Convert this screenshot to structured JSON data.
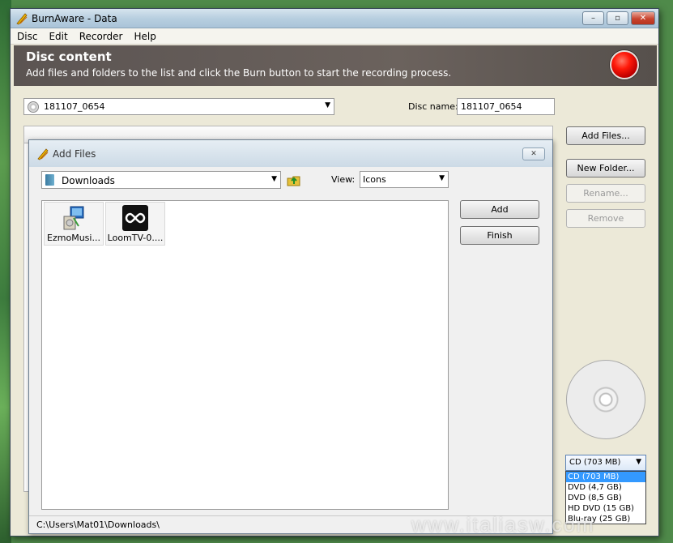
{
  "window": {
    "title": "BurnAware - Data",
    "controls": {
      "minimize": "–",
      "maximize": "▫",
      "close": "✕"
    }
  },
  "menu": [
    "Disc",
    "Edit",
    "Recorder",
    "Help"
  ],
  "banner": {
    "title": "Disc content",
    "subtitle": "Add files and folders to the list and click the Burn button to start the recording process."
  },
  "disc": {
    "selector_value": "181107_0654",
    "name_label": "Disc name:",
    "name_value": "181107_0654"
  },
  "side_buttons": {
    "add_files": "Add Files...",
    "new_folder": "New Folder...",
    "rename": "Rename...",
    "remove": "Remove"
  },
  "media": {
    "selected": "CD (703 MB)",
    "options": [
      "CD (703 MB)",
      "DVD (4,7 GB)",
      "DVD (8,5 GB)",
      "HD DVD (15 GB)",
      "Blu-ray (25 GB)"
    ]
  },
  "watermark": "www.italiasw.com",
  "dialog": {
    "title": "Add Files",
    "close": "✕",
    "folder": "Downloads",
    "view_label": "View:",
    "view_value": "Icons",
    "files": [
      {
        "label": "EzmoMusi...",
        "icon": "installer-icon"
      },
      {
        "label": "LoomTV-0....",
        "icon": "loomtv-app-icon"
      }
    ],
    "add_button": "Add",
    "finish_button": "Finish",
    "status_path": "C:\\Users\\Mat01\\Downloads\\"
  },
  "colors": {
    "banner": "#5f5754",
    "burn": "#ff1a0a",
    "selection": "#3399ff"
  }
}
